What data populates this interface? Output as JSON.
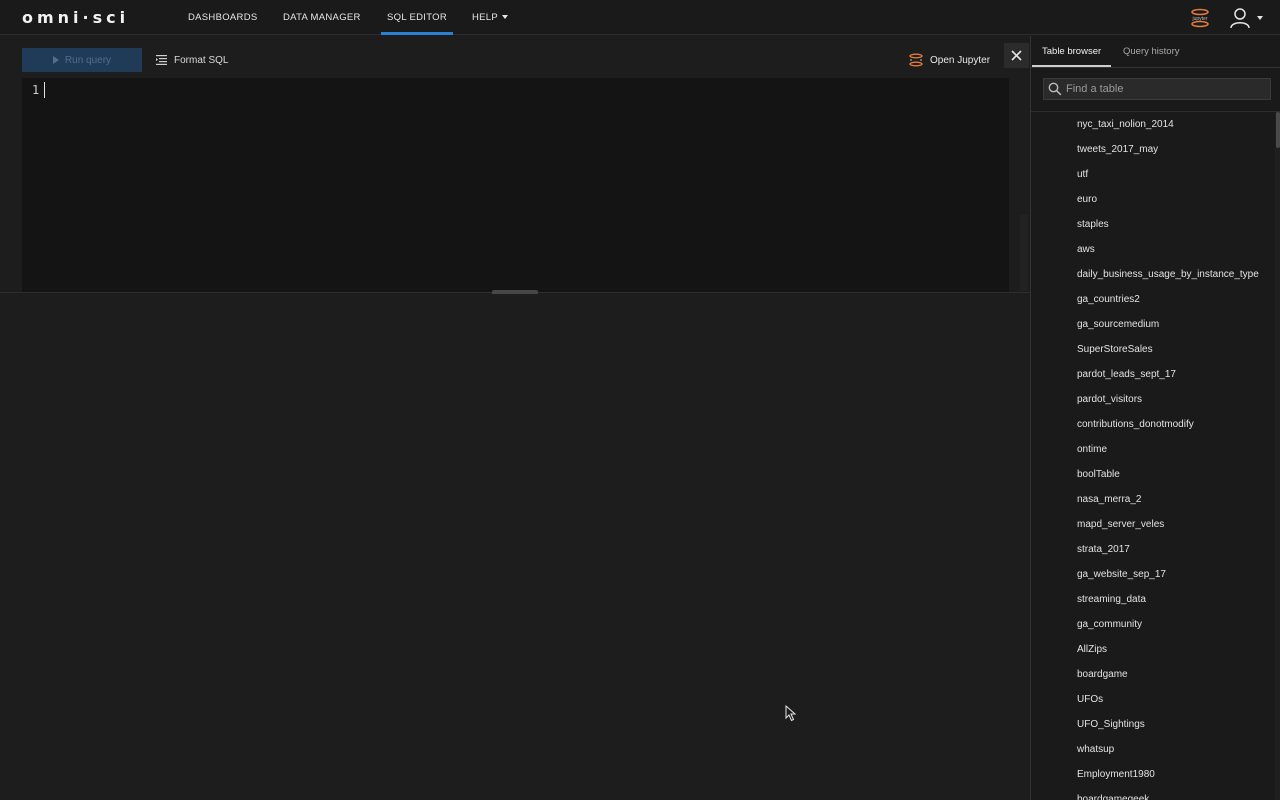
{
  "brand": {
    "logo": "omni·sci"
  },
  "nav": {
    "items": [
      {
        "label": "DASHBOARDS"
      },
      {
        "label": "DATA MANAGER"
      },
      {
        "label": "SQL EDITOR"
      },
      {
        "label": "HELP"
      }
    ],
    "active": "SQL EDITOR",
    "accent_color": "#2b7fd4"
  },
  "header_icons": {
    "jupyter": "jupyter-logo-icon",
    "user": "user-icon",
    "user_menu": "chevron-down-icon"
  },
  "toolbar": {
    "run_label": "Run query",
    "format_label": "Format SQL",
    "jupyter_label": "Open Jupyter",
    "run_state": "disabled"
  },
  "editor": {
    "line_numbers": [
      "1"
    ],
    "content": ""
  },
  "sidebar": {
    "tabs": [
      {
        "label": "Table browser"
      },
      {
        "label": "Query history"
      }
    ],
    "active_tab": "Table browser",
    "search_placeholder": "Find a table",
    "tables": [
      "nyc_taxi_nolion_2014",
      "tweets_2017_may",
      "utf",
      "euro",
      "staples",
      "aws",
      "daily_business_usage_by_instance_type",
      "ga_countries2",
      "ga_sourcemedium",
      "SuperStoreSales",
      "pardot_leads_sept_17",
      "pardot_visitors",
      "contributions_donotmodify",
      "ontime",
      "boolTable",
      "nasa_merra_2",
      "mapd_server_veles",
      "strata_2017",
      "ga_website_sep_17",
      "streaming_data",
      "ga_community",
      "AllZips",
      "boardgame",
      "UFOs",
      "UFO_Sightings",
      "whatsup",
      "Employment1980",
      "boardgamegeek"
    ]
  }
}
